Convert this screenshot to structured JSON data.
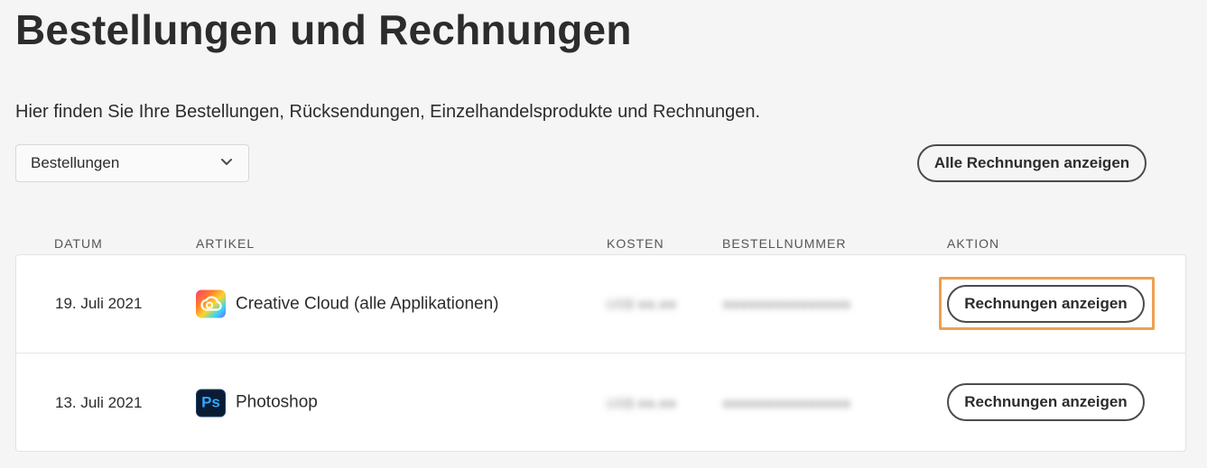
{
  "page": {
    "title": "Bestellungen und Rechnungen",
    "intro": "Hier finden Sie Ihre Bestellungen, Rücksendungen, Einzelhandelsprodukte und Rechnungen."
  },
  "filter": {
    "selected": "Bestellungen",
    "icon": "chevron-down-icon"
  },
  "actions": {
    "all_invoices_label": "Alle Rechnungen anzeigen"
  },
  "table": {
    "headers": {
      "date": "DATUM",
      "item": "ARTIKEL",
      "cost": "KOSTEN",
      "order_number": "BESTELLNUMMER",
      "action": "AKTION"
    },
    "rows": [
      {
        "date": "19. Juli 2021",
        "item": "Creative Cloud (alle Applikationen)",
        "icon": "creative-cloud-icon",
        "cost": "US$ ●●,●●",
        "order_number": "●●●●●●●●●●●●●●●",
        "action_label": "Rechnungen anzeigen",
        "highlighted": true
      },
      {
        "date": "13. Juli 2021",
        "item": "Photoshop",
        "icon": "photoshop-icon",
        "icon_text": "Ps",
        "cost": "US$ ●●,●●",
        "order_number": "●●●●●●●●●●●●●●●",
        "action_label": "Rechnungen anzeigen",
        "highlighted": false
      }
    ]
  },
  "colors": {
    "background": "#f5f5f5",
    "highlight_border": "#f0a050",
    "button_border": "#4b4b4b"
  }
}
